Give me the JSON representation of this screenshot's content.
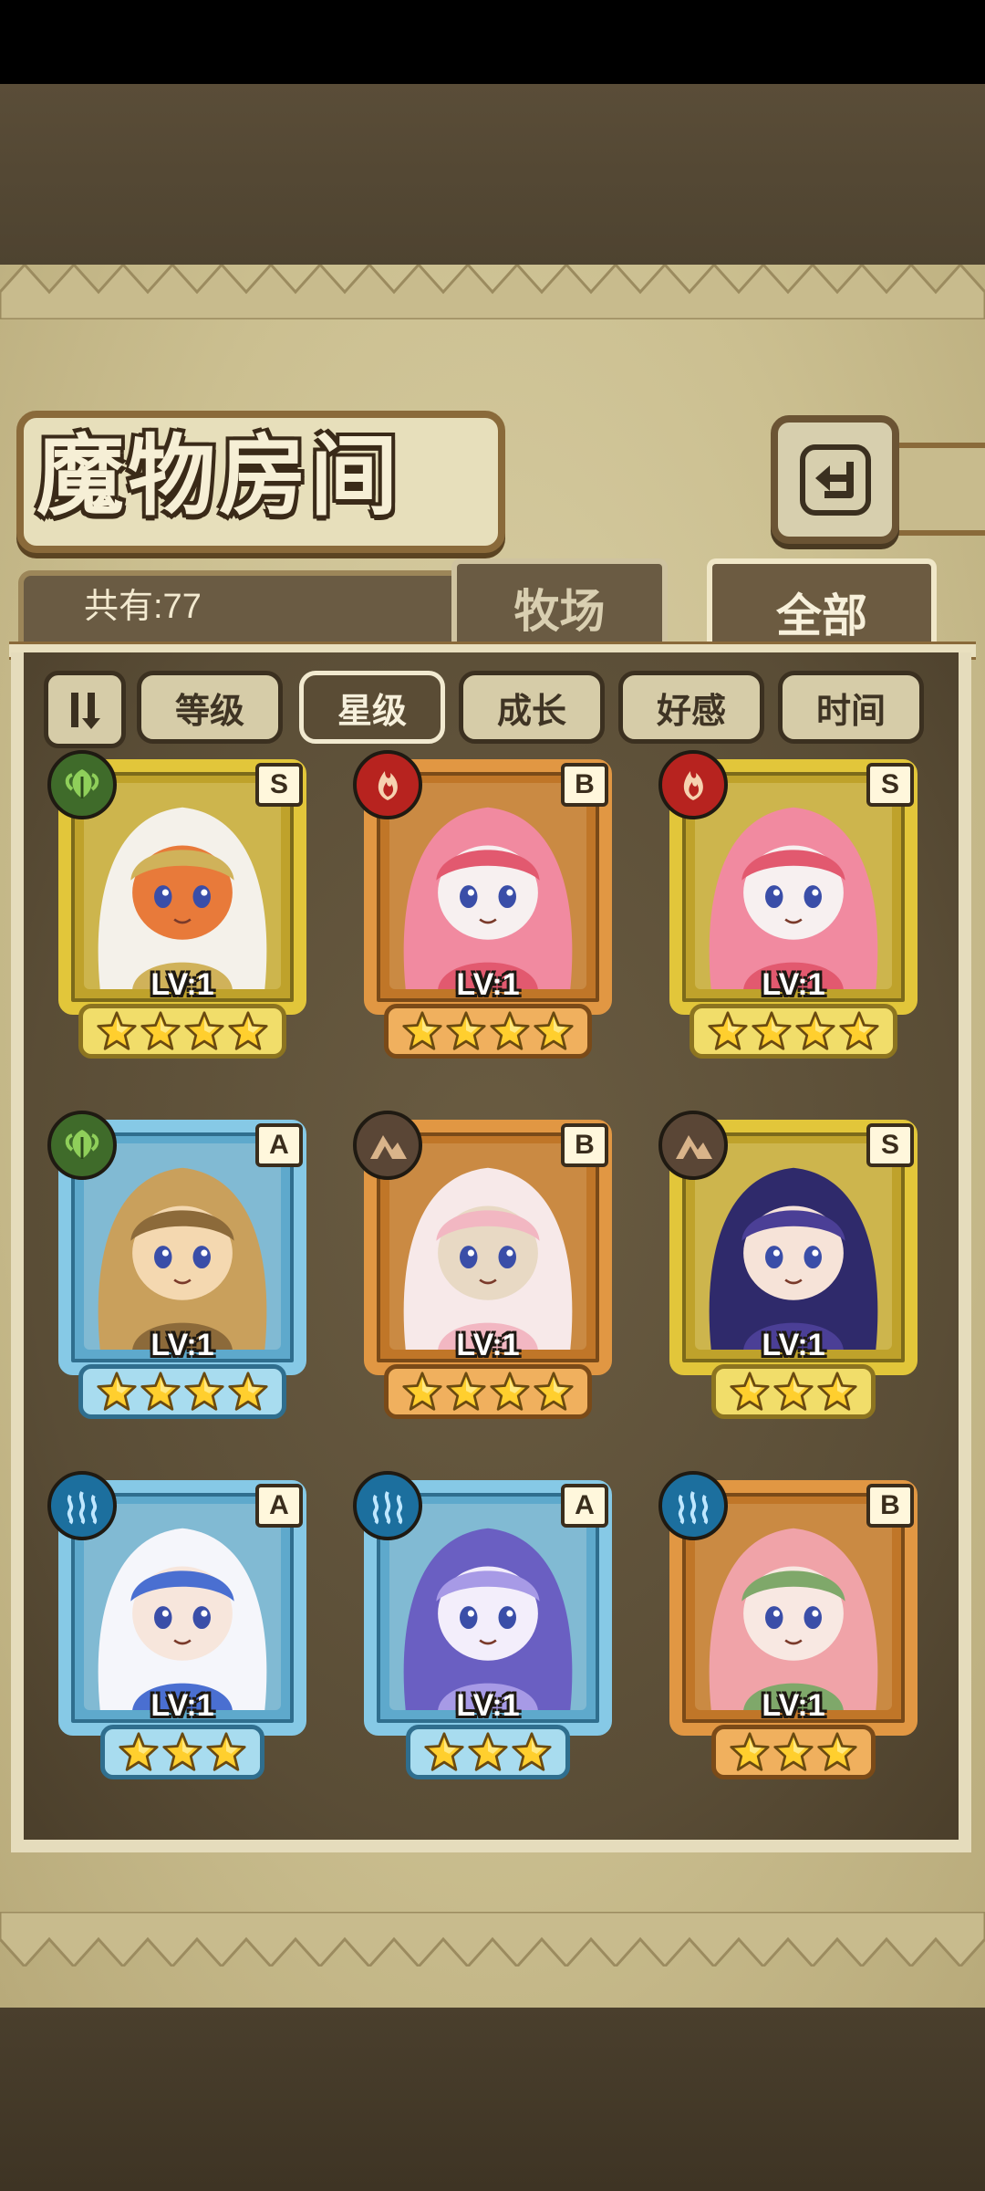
{
  "screen": {
    "title": "魔物房间",
    "back_icon": "return-arrow-icon"
  },
  "header": {
    "count_label": "共有:77",
    "tabs": [
      {
        "label": "牧场",
        "active": false
      },
      {
        "label": "全部",
        "active": true
      }
    ]
  },
  "sort": {
    "toggle_icon": "sort-order-icon",
    "options": [
      {
        "label": "等级",
        "selected": false
      },
      {
        "label": "星级",
        "selected": true
      },
      {
        "label": "成长",
        "selected": false
      },
      {
        "label": "好感",
        "selected": false
      },
      {
        "label": "时间",
        "selected": false
      }
    ]
  },
  "monsters": [
    {
      "rank": "S",
      "element": "leaf",
      "frame": "gold",
      "level": "LV:1",
      "stars": 4,
      "palette": [
        "#f4f1ea",
        "#d0b25a",
        "#e87a3a"
      ]
    },
    {
      "rank": "B",
      "element": "fire",
      "frame": "bronze",
      "level": "LV:1",
      "stars": 4,
      "palette": [
        "#f18aa0",
        "#e2596f",
        "#f7f0f0"
      ]
    },
    {
      "rank": "S",
      "element": "fire",
      "frame": "gold",
      "level": "LV:1",
      "stars": 4,
      "palette": [
        "#f18aa0",
        "#e2596f",
        "#f7f0f0"
      ]
    },
    {
      "rank": "A",
      "element": "leaf",
      "frame": "silver",
      "level": "LV:1",
      "stars": 4,
      "palette": [
        "#c9a05c",
        "#8c6a3a",
        "#f4d8b0"
      ]
    },
    {
      "rank": "B",
      "element": "rock",
      "frame": "bronze",
      "level": "LV:1",
      "stars": 4,
      "palette": [
        "#f7e9e9",
        "#f2b7c2",
        "#e8d9c4"
      ]
    },
    {
      "rank": "S",
      "element": "rock",
      "frame": "gold",
      "level": "LV:1",
      "stars": 3,
      "palette": [
        "#2f2a6b",
        "#4b3f96",
        "#f6e3d8"
      ]
    },
    {
      "rank": "A",
      "element": "water",
      "frame": "silver",
      "level": "LV:1",
      "stars": 3,
      "palette": [
        "#f5f6fb",
        "#4a6fd1",
        "#f7e6dc"
      ]
    },
    {
      "rank": "A",
      "element": "water",
      "frame": "silver",
      "level": "LV:1",
      "stars": 3,
      "palette": [
        "#6a5fc2",
        "#a79ae6",
        "#f3eefb"
      ]
    },
    {
      "rank": "B",
      "element": "water",
      "frame": "bronze",
      "level": "LV:1",
      "stars": 3,
      "palette": [
        "#f0a3a8",
        "#7fa86a",
        "#f8e8e2"
      ]
    }
  ]
}
